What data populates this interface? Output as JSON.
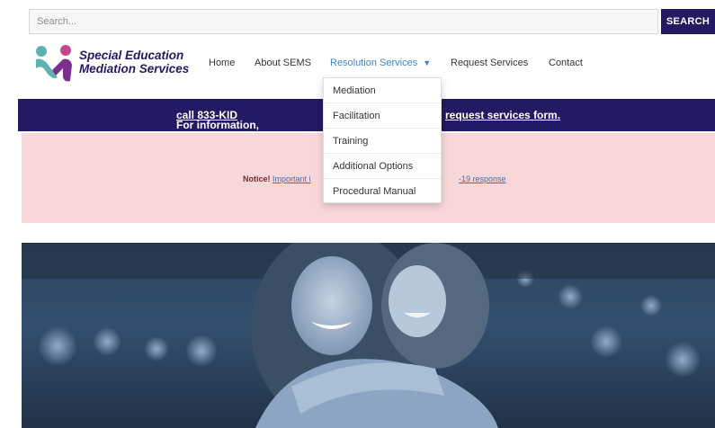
{
  "search": {
    "placeholder": "Search...",
    "button_label": "SEARCH"
  },
  "logo": {
    "line1": "Special Education",
    "line2": "Mediation Services"
  },
  "nav": {
    "home": "Home",
    "about": "About SEMS",
    "resolution": "Resolution Services",
    "request": "Request Services",
    "contact": "Contact"
  },
  "dropdown": {
    "items": [
      "Mediation",
      "Facilitation",
      "Training",
      "Additional Options",
      "Procedural Manual"
    ]
  },
  "info_bar": {
    "prefix": "For information,",
    "link_left": "call 833-KID",
    "link_right": "request services form."
  },
  "notice": {
    "label": "Notice!",
    "link_left": "Important i",
    "link_right": "-19 response"
  },
  "colors": {
    "navy": "#241a63",
    "accent_blue": "#3a86c8",
    "notice_bg": "#f8d7da",
    "logo_teal": "#5bb3b0",
    "logo_purple": "#7b2f8e",
    "logo_pink": "#c2478f"
  }
}
